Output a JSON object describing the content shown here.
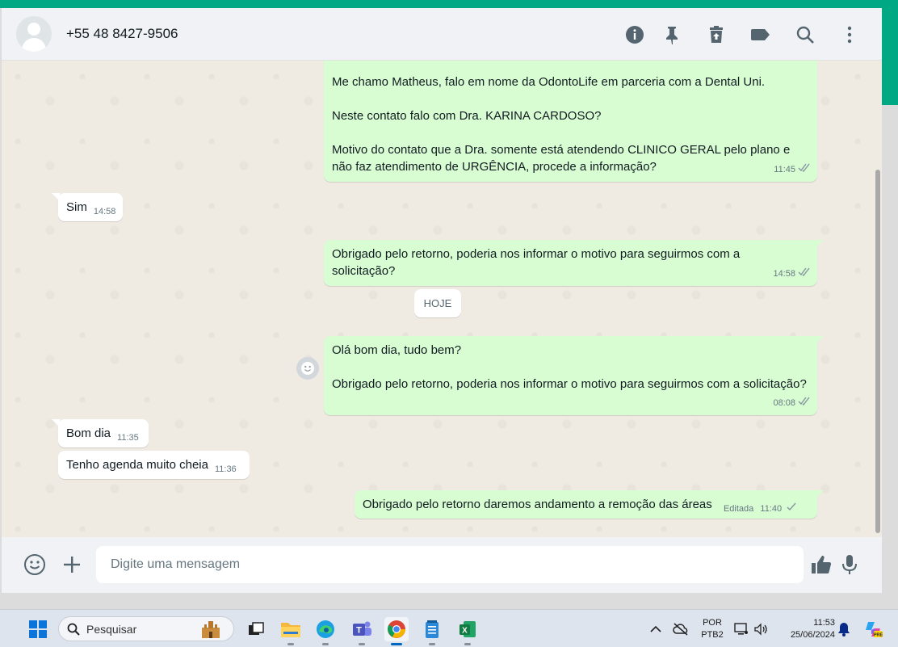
{
  "header": {
    "contact_name": "+55 48 8427-9506",
    "icons": [
      "info-icon",
      "pin-icon",
      "delete-icon",
      "label-icon",
      "search-icon",
      "more-vertical-icon"
    ]
  },
  "messages": [
    {
      "dir": "out",
      "text": "Me chamo Matheus, falo em nome da OdontoLife em parceria com a Dental Uni.\n\nNeste contato falo com Dra. KARINA CARDOSO?\n\nMotivo do contato que a Dra. somente está atendendo CLINICO GERAL pelo plano e não faz atendimento de URGÊNCIA, procede a informação?",
      "time": "11:45",
      "status": "read"
    },
    {
      "dir": "in",
      "text": "Sim",
      "time": "14:58"
    },
    {
      "dir": "out",
      "text": "Obrigado pelo retorno, poderia nos informar o motivo para seguirmos com a solicitação?",
      "time": "14:58",
      "status": "read"
    },
    {
      "dir": "out",
      "text": "Olá bom dia, tudo bem?\n\nObrigado pelo retorno, poderia nos informar o motivo para seguirmos com a solicitação?",
      "time": "08:08",
      "status": "read"
    },
    {
      "dir": "in",
      "text": "Bom dia",
      "time": "11:35"
    },
    {
      "dir": "in",
      "text": "Tenho agenda muito cheia",
      "time": "11:36"
    },
    {
      "dir": "out",
      "text": "Obrigado pelo retorno daremos andamento a remoção das áreas",
      "edited_label": "Editada",
      "time": "11:40",
      "status": "sent"
    }
  ],
  "date_divider": "HOJE",
  "composer": {
    "placeholder": "Digite uma mensagem"
  },
  "taskbar": {
    "search_label": "Pesquisar",
    "language": "POR",
    "keyboard": "PTB2",
    "clock_time": "11:53",
    "clock_date": "25/06/2024"
  },
  "colors": {
    "accent": "#00a884",
    "outgoing_bubble": "#d9fdd3",
    "incoming_bubble": "#ffffff",
    "read_check": "#53bdeb"
  }
}
